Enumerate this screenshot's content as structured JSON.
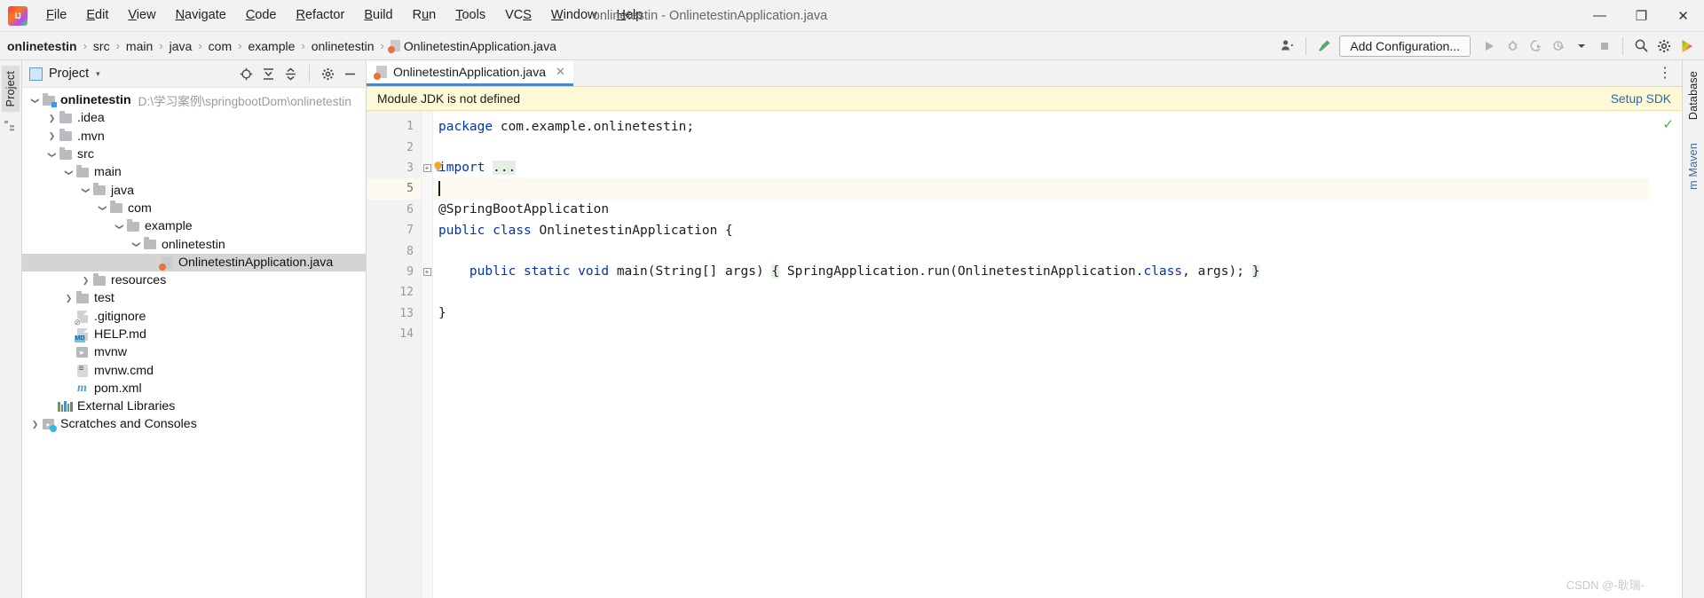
{
  "window": {
    "title": "onlinetestin - OnlinetestinApplication.java",
    "minimize": "—",
    "maximize": "❐",
    "close": "✕"
  },
  "menu": {
    "items": [
      {
        "pre": "",
        "mn": "F",
        "post": "ile"
      },
      {
        "pre": "",
        "mn": "E",
        "post": "dit"
      },
      {
        "pre": "",
        "mn": "V",
        "post": "iew"
      },
      {
        "pre": "",
        "mn": "N",
        "post": "avigate"
      },
      {
        "pre": "",
        "mn": "C",
        "post": "ode"
      },
      {
        "pre": "",
        "mn": "R",
        "post": "efactor"
      },
      {
        "pre": "",
        "mn": "B",
        "post": "uild"
      },
      {
        "pre": "R",
        "mn": "u",
        "post": "n"
      },
      {
        "pre": "",
        "mn": "T",
        "post": "ools"
      },
      {
        "pre": "VC",
        "mn": "S",
        "post": ""
      },
      {
        "pre": "",
        "mn": "W",
        "post": "indow"
      },
      {
        "pre": "",
        "mn": "H",
        "post": "elp"
      }
    ]
  },
  "breadcrumb": {
    "separator": "›",
    "items": [
      {
        "label": "onlinetestin",
        "bold": true,
        "icon": "none"
      },
      {
        "label": "src",
        "bold": false,
        "icon": "none"
      },
      {
        "label": "main",
        "bold": false,
        "icon": "none"
      },
      {
        "label": "java",
        "bold": false,
        "icon": "none"
      },
      {
        "label": "com",
        "bold": false,
        "icon": "none"
      },
      {
        "label": "example",
        "bold": false,
        "icon": "none"
      },
      {
        "label": "onlinetestin",
        "bold": false,
        "icon": "none"
      },
      {
        "label": "OnlinetestinApplication.java",
        "bold": false,
        "icon": "java-file-icon"
      }
    ]
  },
  "toolbar": {
    "add_configuration": "Add Configuration...",
    "icons": [
      "user-settings-icon",
      "build-hammer-icon",
      "run-icon",
      "debug-icon",
      "run-with-coverage-icon",
      "profiler-icon",
      "stop-icon",
      "search-icon",
      "settings-gear-icon",
      "ide-updates-icon"
    ]
  },
  "left_strip": {
    "tabs": [
      "Project",
      "Structure"
    ]
  },
  "right_strip": {
    "tabs": [
      "Database",
      "m Maven"
    ]
  },
  "project_panel": {
    "title": "Project",
    "caret": "▾",
    "tool_icons": [
      "locate-icon",
      "expand-all-icon",
      "collapse-all-icon",
      "settings-gear-icon",
      "hide-icon"
    ],
    "tree": [
      {
        "depth": 0,
        "arrow": "down",
        "icon": "module-folder-icon",
        "label": "onlinetestin",
        "bold": true,
        "path": "D:\\学习案例\\springbootDom\\onlinetestin",
        "selected": false
      },
      {
        "depth": 1,
        "arrow": "right",
        "icon": "folder-icon",
        "label": ".idea",
        "bold": false,
        "path": "",
        "selected": false
      },
      {
        "depth": 1,
        "arrow": "right",
        "icon": "folder-icon",
        "label": ".mvn",
        "bold": false,
        "path": "",
        "selected": false
      },
      {
        "depth": 1,
        "arrow": "down",
        "icon": "folder-icon",
        "label": "src",
        "bold": false,
        "path": "",
        "selected": false
      },
      {
        "depth": 2,
        "arrow": "down",
        "icon": "folder-icon",
        "label": "main",
        "bold": false,
        "path": "",
        "selected": false
      },
      {
        "depth": 3,
        "arrow": "down",
        "icon": "folder-icon",
        "label": "java",
        "bold": false,
        "path": "",
        "selected": false
      },
      {
        "depth": 4,
        "arrow": "down",
        "icon": "folder-icon",
        "label": "com",
        "bold": false,
        "path": "",
        "selected": false
      },
      {
        "depth": 5,
        "arrow": "down",
        "icon": "folder-icon",
        "label": "example",
        "bold": false,
        "path": "",
        "selected": false
      },
      {
        "depth": 6,
        "arrow": "down",
        "icon": "folder-icon",
        "label": "onlinetestin",
        "bold": false,
        "path": "",
        "selected": false
      },
      {
        "depth": 7,
        "arrow": "none",
        "icon": "java-class-icon",
        "label": "OnlinetestinApplication.java",
        "bold": false,
        "path": "",
        "selected": true
      },
      {
        "depth": 3,
        "arrow": "right",
        "icon": "folder-icon",
        "label": "resources",
        "bold": false,
        "path": "",
        "selected": false
      },
      {
        "depth": 2,
        "arrow": "right",
        "icon": "folder-icon",
        "label": "test",
        "bold": false,
        "path": "",
        "selected": false
      },
      {
        "depth": 2,
        "arrow": "none",
        "icon": "gitignore-file-icon",
        "label": ".gitignore",
        "bold": false,
        "path": "",
        "selected": false
      },
      {
        "depth": 2,
        "arrow": "none",
        "icon": "markdown-file-icon",
        "label": "HELP.md",
        "bold": false,
        "path": "",
        "selected": false
      },
      {
        "depth": 2,
        "arrow": "none",
        "icon": "shell-script-icon",
        "label": "mvnw",
        "bold": false,
        "path": "",
        "selected": false
      },
      {
        "depth": 2,
        "arrow": "none",
        "icon": "cmd-file-icon",
        "label": "mvnw.cmd",
        "bold": false,
        "path": "",
        "selected": false
      },
      {
        "depth": 2,
        "arrow": "none",
        "icon": "maven-pom-icon",
        "label": "pom.xml",
        "bold": false,
        "path": "",
        "selected": false
      },
      {
        "depth": 1,
        "arrow": "none",
        "icon": "external-libraries-icon",
        "label": "External Libraries",
        "bold": false,
        "path": "",
        "selected": false
      },
      {
        "depth": 0,
        "arrow": "right",
        "icon": "scratches-icon",
        "label": "Scratches and Consoles",
        "bold": false,
        "path": "",
        "selected": false
      }
    ]
  },
  "editor": {
    "tab": {
      "label": "OnlinetestinApplication.java",
      "close": "✕",
      "icon": "java-class-icon"
    },
    "tab_overflow": "⋮",
    "notification": {
      "message": "Module JDK is not defined",
      "action": "Setup SDK"
    },
    "inspection_status": "✓",
    "lines": [
      {
        "num": "1",
        "fold": "",
        "current": false,
        "bulb": false,
        "tokens": [
          {
            "t": "package",
            "c": "kw"
          },
          {
            "t": " com.example.onlinetestin;",
            "c": ""
          }
        ]
      },
      {
        "num": "2",
        "fold": "",
        "current": false,
        "bulb": false,
        "tokens": [
          {
            "t": "",
            "c": ""
          }
        ]
      },
      {
        "num": "3",
        "fold": "plus",
        "current": false,
        "bulb": true,
        "tokens": [
          {
            "t": "import",
            "c": "kw"
          },
          {
            "t": " ",
            "c": ""
          },
          {
            "t": "...",
            "c": "fold"
          }
        ]
      },
      {
        "num": "5",
        "fold": "",
        "current": true,
        "bulb": false,
        "caret": true,
        "tokens": [
          {
            "t": "",
            "c": ""
          }
        ]
      },
      {
        "num": "6",
        "fold": "",
        "current": false,
        "bulb": false,
        "tokens": [
          {
            "t": "@SpringBootApplication",
            "c": ""
          }
        ]
      },
      {
        "num": "7",
        "fold": "",
        "current": false,
        "bulb": false,
        "tokens": [
          {
            "t": "public",
            "c": "kw"
          },
          {
            "t": " ",
            "c": ""
          },
          {
            "t": "class",
            "c": "kw"
          },
          {
            "t": " OnlinetestinApplication {",
            "c": ""
          }
        ]
      },
      {
        "num": "8",
        "fold": "",
        "current": false,
        "bulb": false,
        "tokens": [
          {
            "t": "",
            "c": ""
          }
        ]
      },
      {
        "num": "9",
        "fold": "plus",
        "current": false,
        "bulb": false,
        "tokens": [
          {
            "t": "    ",
            "c": ""
          },
          {
            "t": "public",
            "c": "kw"
          },
          {
            "t": " ",
            "c": ""
          },
          {
            "t": "static",
            "c": "kw"
          },
          {
            "t": " ",
            "c": ""
          },
          {
            "t": "void",
            "c": "kw"
          },
          {
            "t": " main(String[] args) ",
            "c": ""
          },
          {
            "t": "{",
            "c": "fold"
          },
          {
            "t": " SpringApplication.run(OnlinetestinApplication.",
            "c": ""
          },
          {
            "t": "class",
            "c": "kw"
          },
          {
            "t": ", args); ",
            "c": ""
          },
          {
            "t": "}",
            "c": "fold"
          }
        ]
      },
      {
        "num": "12",
        "fold": "",
        "current": false,
        "bulb": false,
        "tokens": [
          {
            "t": "",
            "c": ""
          }
        ]
      },
      {
        "num": "13",
        "fold": "",
        "current": false,
        "bulb": false,
        "tokens": [
          {
            "t": "}",
            "c": ""
          }
        ]
      },
      {
        "num": "14",
        "fold": "",
        "current": false,
        "bulb": false,
        "tokens": [
          {
            "t": "",
            "c": ""
          }
        ]
      }
    ]
  },
  "watermark": "CSDN @-耿瑞-",
  "colors": {
    "accent_blue": "#4a86c8",
    "keyword": "#0033b3",
    "link": "#2a6ab5",
    "notification_bg": "#fdf8d6",
    "fold_bg": "#e3f0e3",
    "selection": "#d4d4d4",
    "current_line": "#fcfaef"
  }
}
